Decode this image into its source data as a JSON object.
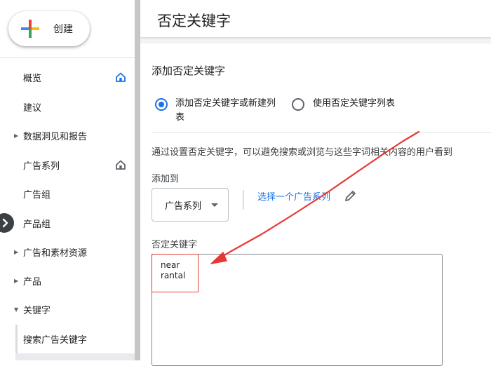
{
  "sidebar": {
    "create_label": "创建",
    "items": [
      {
        "label": "概览"
      },
      {
        "label": "建议"
      },
      {
        "label": "数据洞见和报告"
      },
      {
        "label": "广告系列"
      },
      {
        "label": "广告组"
      },
      {
        "label": "产品组"
      },
      {
        "label": "广告和素材资源"
      },
      {
        "label": "产品"
      },
      {
        "label": "关键字"
      },
      {
        "label": "搜索广告关键字"
      }
    ]
  },
  "header": {
    "title": "否定关键字"
  },
  "form": {
    "title": "添加否定关键字",
    "radio_new_line1": "添加否定关键字或新建列",
    "radio_new_line2": "表",
    "radio_list": "使用否定关键字列表",
    "description": "通过设置否定关键字，可以避免搜索或浏览与这些字词相关内容的用户看到",
    "add_to_label": "添加到",
    "add_to_value": "广告系列",
    "choose_campaign_link": "选择一个广告系列",
    "negative_keywords_label": "否定关键字",
    "negative_keywords": [
      "near",
      "rantal"
    ]
  },
  "colors": {
    "accent": "#1a73e8",
    "annotation": "#e53935"
  },
  "icons": [
    "google-plus-icon",
    "home-icon",
    "caret-right-icon",
    "caret-down-icon",
    "chevron-right-icon",
    "dropdown-arrow-icon",
    "pencil-icon"
  ]
}
